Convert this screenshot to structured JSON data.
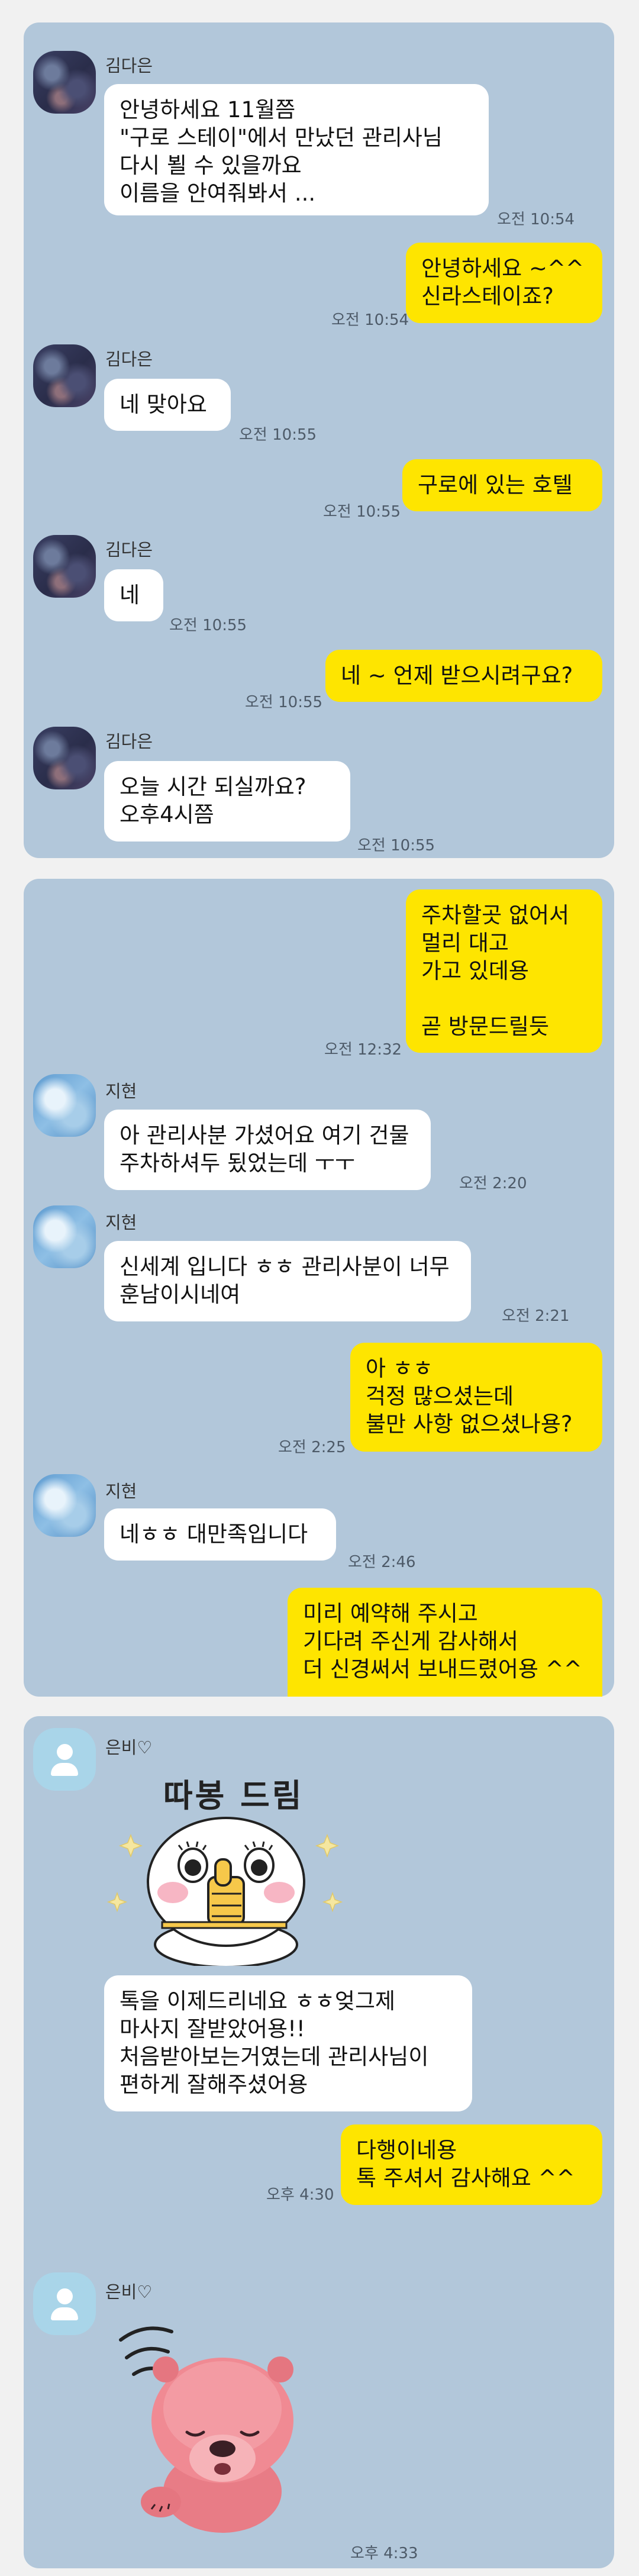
{
  "colors": {
    "chat_background": "#b2c7da",
    "my_bubble": "#fee500",
    "their_bubble": "#ffffff",
    "page_background": "#f1f1f1"
  },
  "screenshots": [
    {
      "messages": [
        {
          "sender": "김다은",
          "text": "안녕하세요 11월쯤\n\"구로 스테이\"에서 만났던 관리사님\n다시 뵐 수 있을까요\n이름을 안여줘봐서 ...",
          "time": "오전 10:54"
        },
        {
          "me": true,
          "text": "안녕하세요 ~^^\n신라스테이죠?",
          "time": "오전 10:54"
        },
        {
          "sender": "김다은",
          "text": "네 맞아요",
          "time": "오전 10:55"
        },
        {
          "me": true,
          "text": "구로에 있는 호텔",
          "time": "오전 10:55"
        },
        {
          "sender": "김다은",
          "text": "네",
          "time": "오전 10:55"
        },
        {
          "me": true,
          "text": "네 ~ 언제 받으시려구요?",
          "time": "오전 10:55"
        },
        {
          "sender": "김다은",
          "text": "오늘  시간 되실까요?\n오후4시쯤",
          "time": "오전 10:55"
        }
      ]
    },
    {
      "messages": [
        {
          "me": true,
          "text": "주차할곳 없어서\n멀리 대고\n가고 있데용\n\n곧 방문드릴듯",
          "time": "오전 12:32"
        },
        {
          "sender": "지현",
          "text": "아 관리사분 가셨어요 여기 건물\n주차하셔두 됬었는데 ㅜㅜ",
          "time": "오전 2:20"
        },
        {
          "sender": "지현",
          "text": "신세계 입니다 ㅎㅎ 관리사분이 너무\n훈남이시네여",
          "time": "오전 2:21"
        },
        {
          "me": true,
          "text": "아 ㅎㅎ\n걱정 많으셨는데\n불만 사항 없으셨나용?",
          "time": "오전 2:25"
        },
        {
          "sender": "지현",
          "text": "네ㅎㅎ 대만족입니다",
          "time": "오전 2:46"
        },
        {
          "me": true,
          "text": "미리 예약해 주시고\n기다려 주신게 감사해서\n더 신경써서 보내드렸어용 ^^",
          "time": ""
        }
      ]
    },
    {
      "messages": [
        {
          "sender": "은비♡",
          "sticker_caption": "따봉 드림",
          "text": "톡을 이제드리네요 ㅎㅎ엊그제\n마사지 잘받았어용!!\n처음받아보는거였는데 관리사님이\n편하게 잘해주셨어용",
          "time": ""
        },
        {
          "me": true,
          "text": "다행이네용\n톡 주셔서 감사해요 ^^",
          "time": "오후 4:30"
        },
        {
          "sender": "은비♡",
          "sticker": "sleeping-pink-beaver",
          "time": "오후 4:33"
        }
      ]
    }
  ],
  "icons": {
    "default_avatar": "person-silhouette-icon",
    "sticker_1": "thumbs-up-character-sticker",
    "sticker_2": "sleeping-pink-beaver-sticker"
  }
}
